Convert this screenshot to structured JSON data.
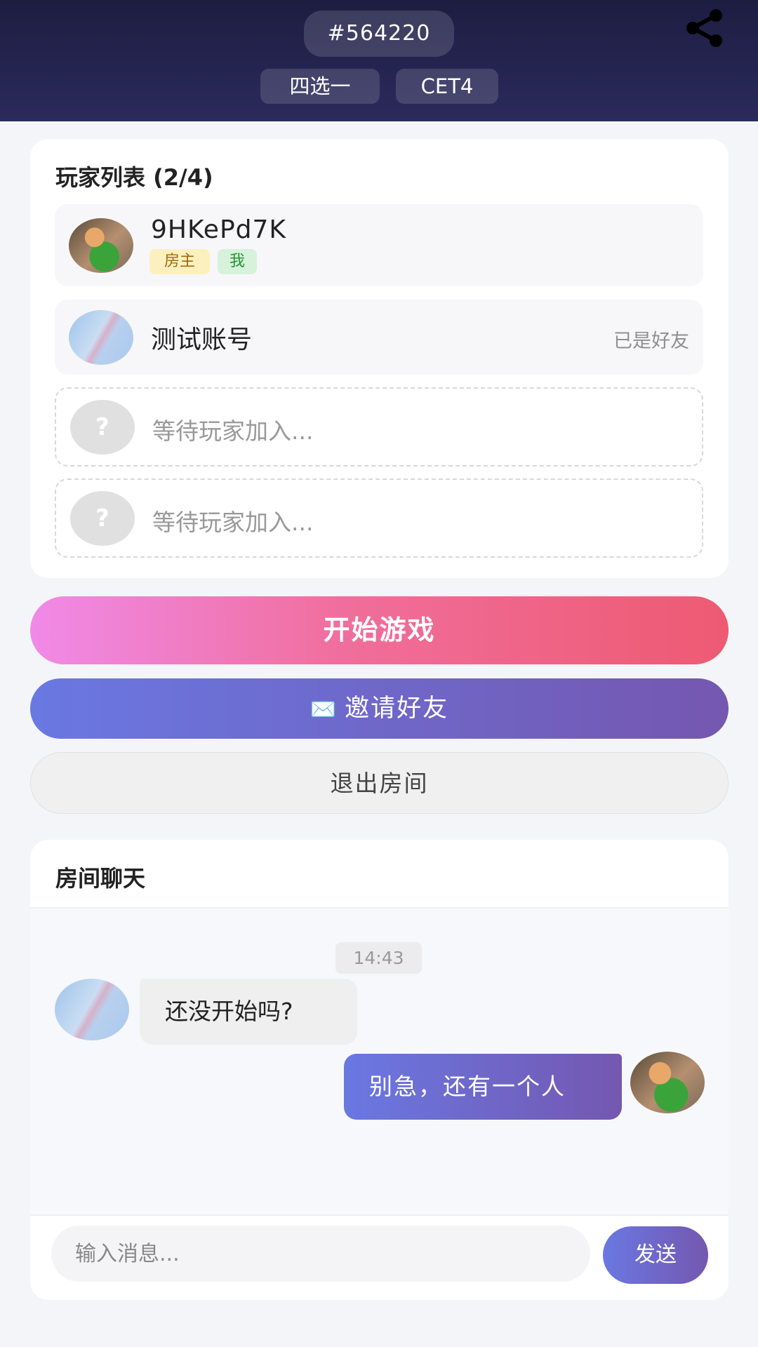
{
  "header": {
    "room_id": "#564220",
    "tags": [
      "四选一",
      "CET4"
    ]
  },
  "players": {
    "title": "玩家列表 (2/4)",
    "list": [
      {
        "name": "9HKePd7K",
        "badges": [
          "房主",
          "我"
        ],
        "avatar": "cat-photo"
      },
      {
        "name": "测试账号",
        "status": "已是好友",
        "avatar": "blue-photo"
      }
    ],
    "empty_slots": [
      {
        "avatar_text": "?",
        "label": "等待玩家加入..."
      },
      {
        "avatar_text": "?",
        "label": "等待玩家加入..."
      }
    ]
  },
  "actions": {
    "start": "开始游戏",
    "invite_icon": "✉️",
    "invite": "邀请好友",
    "leave": "退出房间"
  },
  "chat": {
    "title": "房间聊天",
    "time": "14:43",
    "messages": [
      {
        "side": "left",
        "text": "还没开始吗?",
        "avatar": "blue-photo"
      },
      {
        "side": "right",
        "text": "别急，还有一个人",
        "avatar": "cat-photo"
      }
    ],
    "input_placeholder": "输入消息...",
    "send": "发送"
  },
  "colors": {
    "header_bg": "#1d1d42",
    "start_gradient": [
      "#f08ae8",
      "#ee5a72"
    ],
    "accent_gradient": [
      "#6a78e2",
      "#7457b0"
    ],
    "host_badge": "#fcf0bf",
    "me_badge": "#d6f2da"
  },
  "icons": {
    "share": "share-icon"
  }
}
